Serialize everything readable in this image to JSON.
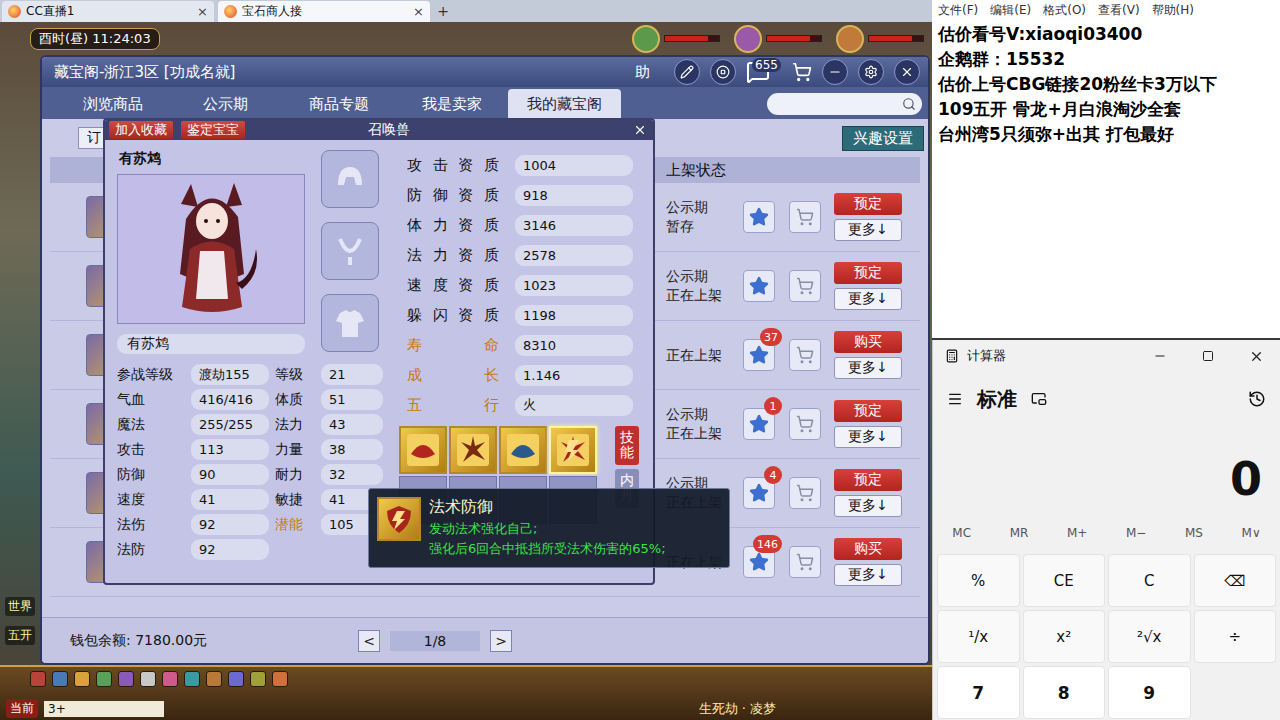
{
  "browser": {
    "tabs": [
      {
        "label": "CC直播1",
        "selected": false
      },
      {
        "label": "宝石商人接",
        "selected": true
      }
    ],
    "close": "×",
    "new_tab": "+"
  },
  "game": {
    "clock": "酉时(昼) 11:24:03",
    "side_labels": [
      "世界",
      "五开"
    ],
    "chat": {
      "channel": "当前",
      "input": "3+"
    },
    "map_label": "生死劫 · 凌梦"
  },
  "pavilion": {
    "title": "藏宝阁-浙江3区 [功成名就]",
    "help": "助",
    "message_badge": "655",
    "tabs": [
      {
        "label": "浏览商品",
        "selected": false
      },
      {
        "label": "公示期",
        "selected": false
      },
      {
        "label": "商品专题",
        "selected": false
      },
      {
        "label": "我是卖家",
        "selected": false
      },
      {
        "label": "我的藏宝阁",
        "selected": true
      }
    ],
    "order_button": "订",
    "interest_button": "兴趣设置",
    "column_header": "上架状态",
    "rows": [
      {
        "status": [
          "公示期",
          "暂存"
        ],
        "badge": "",
        "action": "预定",
        "more": "更多↓"
      },
      {
        "status": [
          "公示期",
          "正在上架"
        ],
        "badge": "",
        "action": "预定",
        "more": "更多↓"
      },
      {
        "status": [
          "正在上架"
        ],
        "badge": "37",
        "action": "购买",
        "more": "更多↓"
      },
      {
        "status": [
          "公示期",
          "正在上架"
        ],
        "badge": "1",
        "action": "预定",
        "more": "更多↓"
      },
      {
        "status": [
          "公示期",
          "正在上架"
        ],
        "badge": "4",
        "action": "预定",
        "more": "更多↓"
      },
      {
        "status": [
          "正在上架"
        ],
        "badge": "146",
        "action": "购买",
        "more": "更多↓"
      }
    ],
    "wallet": "钱包余额: 7180.00元",
    "pager": {
      "prev": "<",
      "page": "1/8",
      "next": ">"
    }
  },
  "pet": {
    "buttons": [
      "加入收藏",
      "鉴定宝宝"
    ],
    "title": "召唤兽",
    "name": "有苏鸩",
    "name_field": "有苏鸩",
    "stats": [
      {
        "label": "参战等级",
        "value": "渡劫155",
        "highlight": false
      },
      {
        "label": "等级",
        "value": "21",
        "highlight": false
      },
      {
        "label": "气血",
        "value": "416/416",
        "highlight": false
      },
      {
        "label": "体质",
        "value": "51",
        "highlight": false
      },
      {
        "label": "魔法",
        "value": "255/255",
        "highlight": false
      },
      {
        "label": "法力",
        "value": "43",
        "highlight": false
      },
      {
        "label": "攻击",
        "value": "113",
        "highlight": false
      },
      {
        "label": "力量",
        "value": "38",
        "highlight": false
      },
      {
        "label": "防御",
        "value": "90",
        "highlight": false
      },
      {
        "label": "耐力",
        "value": "32",
        "highlight": false
      },
      {
        "label": "速度",
        "value": "41",
        "highlight": false
      },
      {
        "label": "敏捷",
        "value": "41",
        "highlight": false
      },
      {
        "label": "法伤",
        "value": "92",
        "highlight": false
      },
      {
        "label": "潜能",
        "value": "105",
        "highlight": true
      },
      {
        "label": "法防",
        "value": "92",
        "highlight": false
      }
    ],
    "aptitudes": [
      {
        "label": "攻击资质",
        "value": "1004",
        "highlight": false
      },
      {
        "label": "防御资质",
        "value": "918",
        "highlight": false
      },
      {
        "label": "体力资质",
        "value": "3146",
        "highlight": false
      },
      {
        "label": "法力资质",
        "value": "2578",
        "highlight": false
      },
      {
        "label": "速度资质",
        "value": "1023",
        "highlight": false
      },
      {
        "label": "躲闪资质",
        "value": "1198",
        "highlight": false
      },
      {
        "label": "寿命",
        "value": "8310",
        "highlight": true
      },
      {
        "label": "成长",
        "value": "1.146",
        "highlight": true
      },
      {
        "label": "五行",
        "value": "火",
        "highlight": true
      }
    ],
    "skills": [
      {
        "selected": false,
        "color": "#b3261e"
      },
      {
        "selected": false,
        "color": "#7a2a10"
      },
      {
        "selected": false,
        "color": "#2b5a8a"
      },
      {
        "selected": true,
        "color": "#a8251c"
      }
    ],
    "side_tabs": [
      {
        "label": "技能",
        "selected": true
      },
      {
        "label": "内丹",
        "selected": false
      }
    ],
    "tooltip": {
      "title": "法术防御",
      "lines": [
        "发动法术强化自己;",
        "强化后6回合中抵挡所受法术伤害的65%;"
      ]
    }
  },
  "notepad": {
    "menu": [
      "文件(F)",
      "编辑(E)",
      "格式(O)",
      "查看(V)",
      "帮助(H)"
    ],
    "lines": [
      "估价看号V:xiaoqi03400",
      "企鹅群：15532",
      "估价上号CBG链接20粉丝卡3万以下",
      "109五开 骨龙+月白浪淘沙全套",
      "台州湾5只须弥+出其 打包最好"
    ]
  },
  "calculator": {
    "title": "计算器",
    "mode": "标准",
    "display": "0",
    "memory": [
      "MC",
      "MR",
      "M+",
      "M−",
      "MS",
      "M∨"
    ],
    "keys": [
      {
        "label": "%",
        "kind": "op"
      },
      {
        "label": "CE",
        "kind": "op"
      },
      {
        "label": "C",
        "kind": "op"
      },
      {
        "label": "⌫",
        "kind": "op"
      },
      {
        "label": "¹/x",
        "kind": "op"
      },
      {
        "label": "x²",
        "kind": "op"
      },
      {
        "label": "²√x",
        "kind": "op"
      },
      {
        "label": "÷",
        "kind": "op"
      },
      {
        "label": "7",
        "kind": "digit"
      },
      {
        "label": "8",
        "kind": "digit"
      },
      {
        "label": "9",
        "kind": "digit"
      }
    ]
  }
}
